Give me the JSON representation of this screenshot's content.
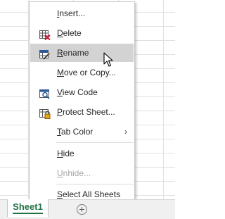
{
  "context_menu": {
    "items": [
      {
        "key": "I",
        "rest": "nsert...",
        "icon": "none"
      },
      {
        "key": "D",
        "rest": "elete",
        "icon": "delete-sheet-icon"
      },
      {
        "key": "R",
        "rest": "ename",
        "icon": "rename-sheet-icon",
        "hovered": true
      },
      {
        "key": "M",
        "rest": "ove or Copy...",
        "icon": "none"
      },
      {
        "key": "V",
        "rest": "iew Code",
        "icon": "view-code-icon"
      },
      {
        "key": "P",
        "rest": "rotect Sheet...",
        "icon": "protect-sheet-icon"
      },
      {
        "key": "T",
        "rest": "ab Color",
        "icon": "none",
        "submenu_arrow": "›"
      },
      {
        "key": "H",
        "rest": "ide",
        "icon": "none"
      },
      {
        "key": "U",
        "rest": "nhide...",
        "icon": "none",
        "disabled": true
      },
      {
        "key": "S",
        "rest": "elect All Sheets",
        "icon": "none"
      }
    ]
  },
  "sheet_tabs": {
    "active_tab": "Sheet1",
    "add_sheet_glyph": "+"
  },
  "colors": {
    "accent_green": "#217346",
    "hover_gray": "#d3d3d3",
    "disabled_text": "#a6a6a6"
  }
}
